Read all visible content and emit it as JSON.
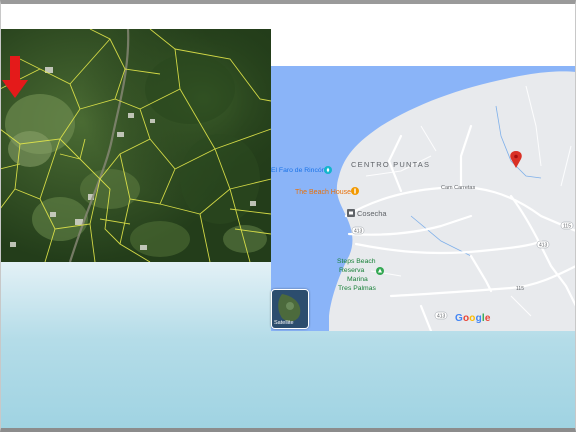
{
  "satellite_image": {
    "alt": "satellite-aerial-view-with-parcel-lines",
    "marker": "red-arrow-icon",
    "colors": {
      "parcel_lines": "#e4e84a",
      "marker": "#e41a1a",
      "vegetation": "#2f4e22"
    }
  },
  "map": {
    "area_label": "CENTRO PUNTAS",
    "places": [
      {
        "name": "El Faro de Rincón",
        "icon": "lighthouse-icon"
      },
      {
        "name": "The Beach House",
        "icon": "restaurant-icon"
      },
      {
        "name": "Cosecha",
        "icon": "store-icon"
      },
      {
        "name": "Steps Beach Reserva Marina Tres Palmas",
        "lines": [
          "Steps Beach",
          "Reserva",
          "Marina",
          "Tres Palmas"
        ],
        "icon": "park-icon"
      }
    ],
    "roads": [
      "Cam Carretas",
      "413",
      "413",
      "413",
      "115",
      "115"
    ],
    "pin": "location-pin-icon",
    "satellite_toggle_label": "Satellite",
    "attribution": "Google",
    "colors": {
      "water": "#8ab4f8",
      "land": "#e8eaed",
      "roads": "#ffffff",
      "pin": "#d93025"
    }
  }
}
